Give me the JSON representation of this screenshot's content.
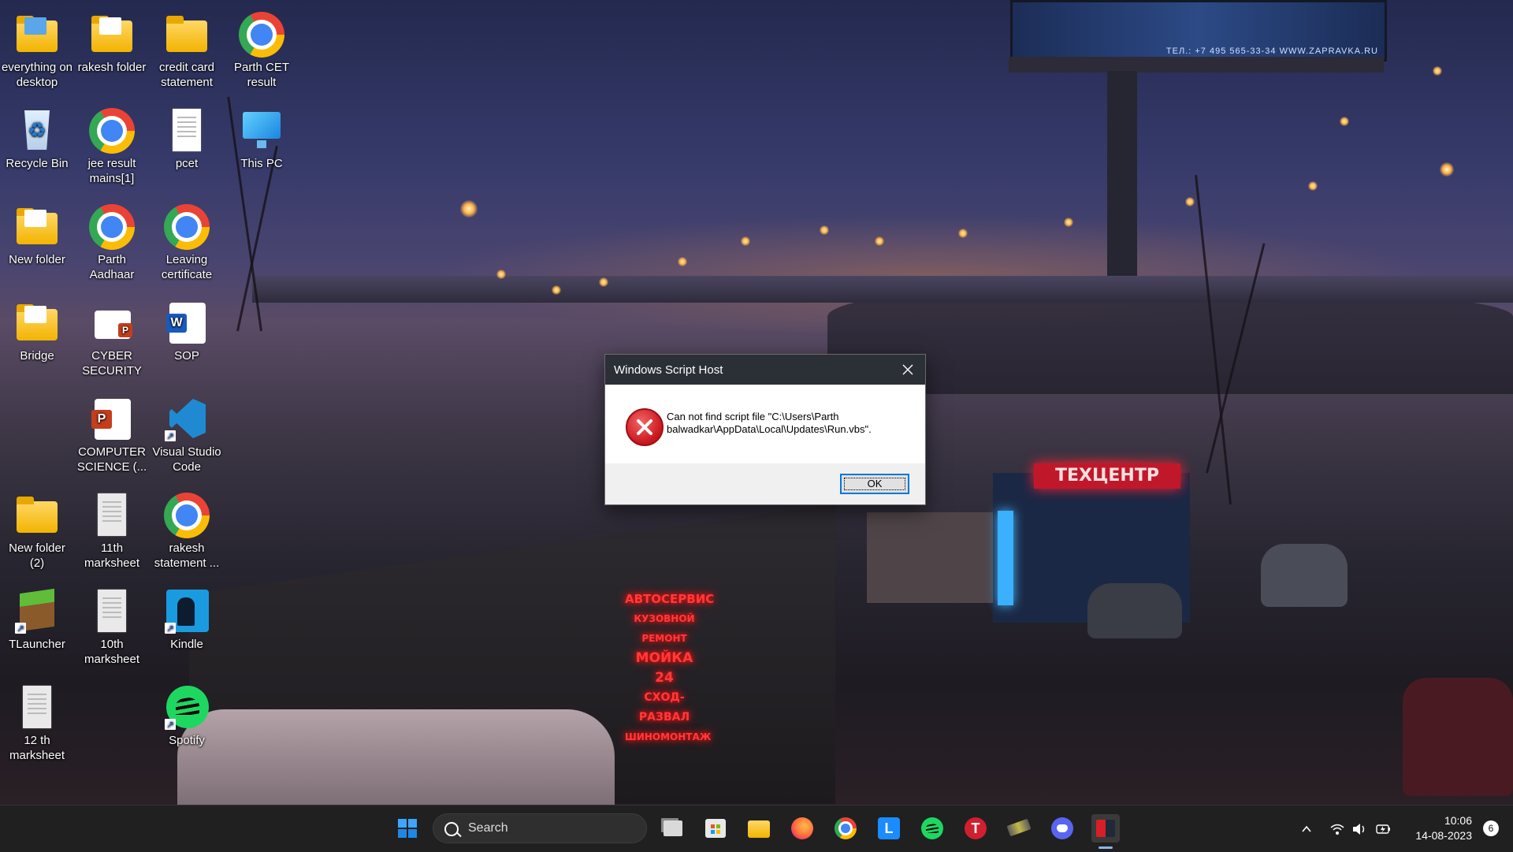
{
  "desktop": {
    "icons": [
      {
        "label": "everything on desktop",
        "type": "folder"
      },
      {
        "label": "rakesh folder",
        "type": "folder"
      },
      {
        "label": "credit card statement",
        "type": "folder"
      },
      {
        "label": "Parth CET result",
        "type": "chrome"
      },
      {
        "label": "Recycle Bin",
        "type": "recycle-bin"
      },
      {
        "label": "jee result mains[1]",
        "type": "chrome"
      },
      {
        "label": "pcet",
        "type": "document"
      },
      {
        "label": "This PC",
        "type": "computer"
      },
      {
        "label": "New folder",
        "type": "folder"
      },
      {
        "label": "Parth Aadhaar",
        "type": "chrome"
      },
      {
        "label": "Leaving certificate",
        "type": "chrome"
      },
      {
        "label": "Bridge",
        "type": "folder"
      },
      {
        "label": "CYBER SECURITY",
        "type": "powerpoint"
      },
      {
        "label": "SOP",
        "type": "word"
      },
      {
        "label": "COMPUTER SCIENCE (...",
        "type": "powerpoint"
      },
      {
        "label": "Visual Studio Code",
        "type": "vscode"
      },
      {
        "label": "New folder (2)",
        "type": "folder"
      },
      {
        "label": "11th marksheet",
        "type": "document"
      },
      {
        "label": "rakesh statement ...",
        "type": "chrome"
      },
      {
        "label": "TLauncher",
        "type": "minecraft"
      },
      {
        "label": "10th marksheet",
        "type": "document"
      },
      {
        "label": "Kindle",
        "type": "kindle"
      },
      {
        "label": "12 th marksheet",
        "type": "document"
      },
      {
        "label": "Spotify",
        "type": "spotify"
      }
    ]
  },
  "wallpaper": {
    "billboard_text": "ТЕЛ.: +7 495 565-33-34   WWW.ZAPRAVKA.RU",
    "neon_lines": [
      "АВТОСЕРВИС",
      "КУЗОВНОЙ РЕМОНТ",
      "МОЙКА 24",
      "СХОД-РАЗВАЛ",
      "ШИНОМОНТАЖ"
    ],
    "shop_sign": "ТЕХЦЕНТР"
  },
  "dialog": {
    "title": "Windows Script Host",
    "message": "Can not find script file \"C:\\Users\\Parth balwadkar\\AppData\\Local\\Updates\\Run.vbs\".",
    "ok_label": "OK",
    "icon": "error-icon"
  },
  "taskbar": {
    "search_placeholder": "Search",
    "apps": [
      "start",
      "task-view",
      "microsoft-store",
      "file-explorer",
      "firefox",
      "chrome",
      "l-app",
      "spotify",
      "t-app",
      "game-app",
      "discord",
      "active-app"
    ],
    "l_app_letter": "L",
    "t_app_letter": "T",
    "clock_time": "10:06",
    "clock_date": "14-08-2023",
    "notification_count": "6"
  },
  "colors": {
    "taskbar": "#202020",
    "dialog_titlebar": "#2b2f36",
    "accent": "#0078d7",
    "error": "#c8161d"
  }
}
